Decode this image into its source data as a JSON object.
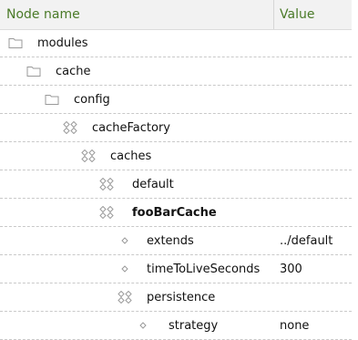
{
  "header": {
    "name_label": "Node name",
    "value_label": "Value"
  },
  "colors": {
    "header_text": "#4a7a28",
    "header_bg": "#f2f2f2",
    "icon_stroke": "#9a9a9a"
  },
  "rows": [
    {
      "label": "modules",
      "value": "",
      "icon": "folder-icon",
      "bold": false
    },
    {
      "label": "cache",
      "value": "",
      "icon": "folder-icon",
      "bold": false
    },
    {
      "label": "config",
      "value": "",
      "icon": "folder-icon",
      "bold": false
    },
    {
      "label": "cacheFactory",
      "value": "",
      "icon": "content-node-icon",
      "bold": false
    },
    {
      "label": "caches",
      "value": "",
      "icon": "content-node-icon",
      "bold": false
    },
    {
      "label": "default",
      "value": "",
      "icon": "content-node-icon",
      "bold": false
    },
    {
      "label": "fooBarCache",
      "value": "",
      "icon": "content-node-icon",
      "bold": true
    },
    {
      "label": "extends",
      "value": "../default",
      "icon": "property-icon",
      "bold": false
    },
    {
      "label": "timeToLiveSeconds",
      "value": "300",
      "icon": "property-icon",
      "bold": false
    },
    {
      "label": "persistence",
      "value": "",
      "icon": "content-node-icon",
      "bold": false
    },
    {
      "label": "strategy",
      "value": "none",
      "icon": "property-icon",
      "bold": false
    }
  ]
}
